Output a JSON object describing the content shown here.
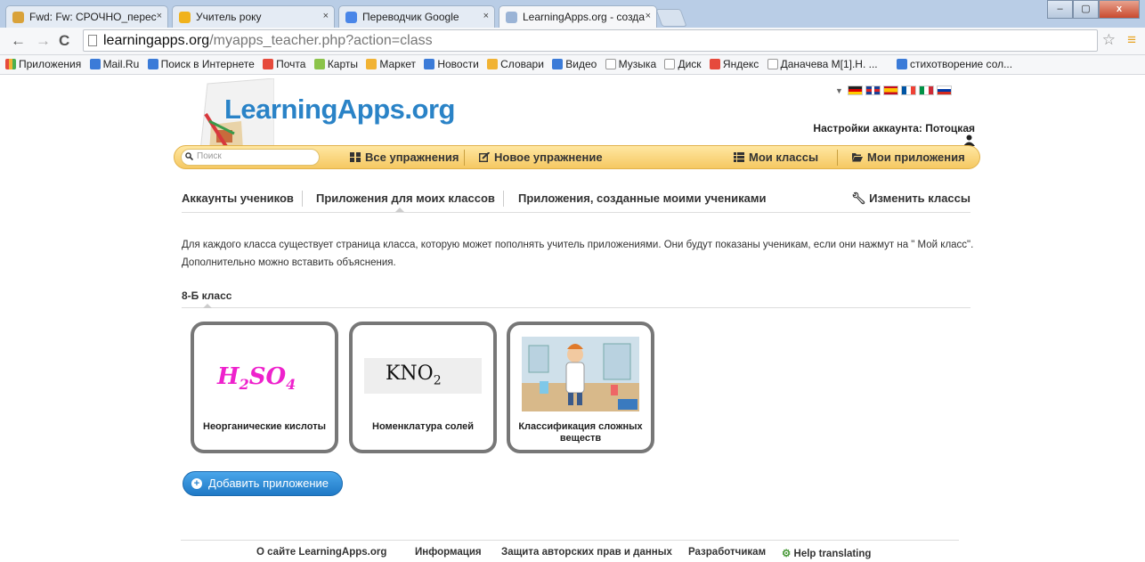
{
  "browser": {
    "tabs": [
      {
        "title": "Fwd: Fw: СРОЧНО_перес",
        "icon_color": "#d9a23a"
      },
      {
        "title": "Учитель року",
        "icon_color": "#f0b21c"
      },
      {
        "title": "Переводчик Google",
        "icon_color": "#4a86e8"
      },
      {
        "title": "LearningApps.org - созда",
        "icon_color": "#9bb4d6"
      }
    ],
    "window_buttons": [
      "–",
      "▢",
      "x"
    ],
    "url_host": "learningapps.org",
    "url_path": "/myapps_teacher.php?action=class",
    "bookmarks": [
      {
        "label": "Приложения",
        "icon_color": "#3b7bd8"
      },
      {
        "label": "Mail.Ru",
        "icon_color": "#3b7bd8"
      },
      {
        "label": "Поиск в Интернете",
        "icon_color": "#3b7bd8"
      },
      {
        "label": "Почта",
        "icon_color": "#e64a3c"
      },
      {
        "label": "Карты",
        "icon_color": "#8bc34a"
      },
      {
        "label": "Маркет",
        "icon_color": "#f1b334"
      },
      {
        "label": "Новости",
        "icon_color": "#3b7bd8"
      },
      {
        "label": "Словари",
        "icon_color": "#f1b334"
      },
      {
        "label": "Видео",
        "icon_color": "#3b7bd8"
      },
      {
        "label": "Музыка",
        "icon_color": "#cccccc"
      },
      {
        "label": "Диск",
        "icon_color": "#cccccc"
      },
      {
        "label": "Яндекс",
        "icon_color": "#e64a3c"
      },
      {
        "label": "Даначева М[1].Н. ...",
        "icon_color": "#cccccc"
      },
      {
        "label": "стихотворение сол...",
        "icon_color": "#3b7bd8"
      }
    ]
  },
  "site": {
    "logo": "LearningApps.org",
    "account_label": "Настройки аккаунта: Потоцкая",
    "search_placeholder": "Поиск",
    "nav": {
      "all": "Все упражнения",
      "new": "Новое упражнение",
      "classes": "Мои классы",
      "apps": "Мои приложения"
    },
    "subnav": {
      "accounts": "Аккаунты учеников",
      "class_apps": "Приложения для моих классов",
      "student_apps": "Приложения, созданные моими учениками",
      "edit": "Изменить классы"
    },
    "description": "Для каждого класса существует страница класса, которую может пополнять учитель приложениями. Они будут показаны ученикам, если они нажмут на \" Мой класс\". Дополнительно можно вставить объяснения.",
    "class_name": "8-Б класс",
    "apps": [
      {
        "title": "Неорганические кислоты",
        "formula": "H",
        "formula_sub1": "2",
        "formula_mid": "SO",
        "formula_sub2": "4"
      },
      {
        "title": "Номенклатура солей",
        "formula": "KNO",
        "formula_sub1": "2"
      },
      {
        "title": "Классификация сложных веществ"
      }
    ],
    "add_button": "Добавить приложение",
    "footer": {
      "about": "О сайте LearningApps.org",
      "info": "Информация",
      "copyright": "Защита авторских прав и данных",
      "dev": "Разработчикам",
      "help": "Help translating"
    }
  }
}
